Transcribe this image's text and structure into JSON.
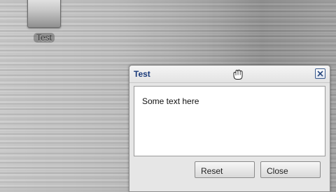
{
  "desktop": {
    "icons": [
      {
        "label": "Test",
        "icon": "app-icon"
      }
    ]
  },
  "dialog": {
    "title": "Test",
    "grip_icon": "grab-hand-icon",
    "close_icon": "close-icon",
    "body_text": "Some text here",
    "buttons": {
      "reset_label": "Reset",
      "close_label": "Close"
    }
  }
}
